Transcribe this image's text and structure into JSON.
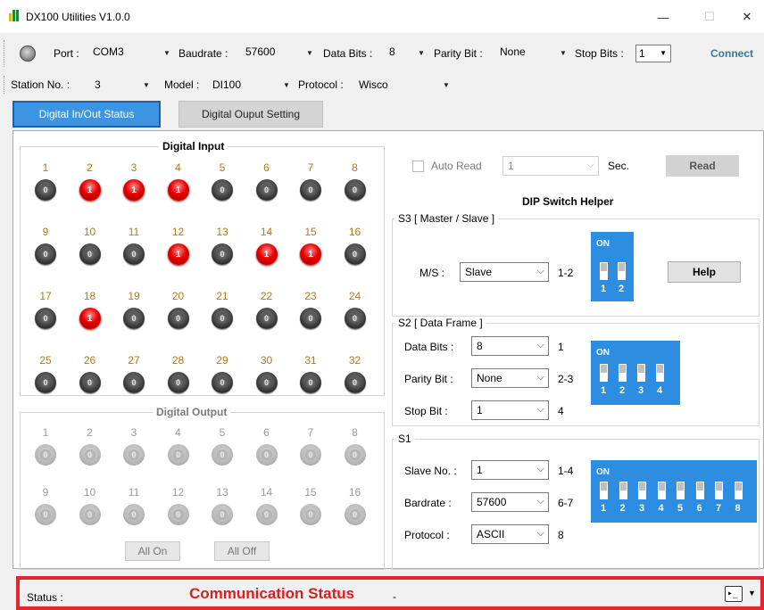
{
  "window": {
    "title": "DX100 Utilities V1.0.0",
    "minimize": "—",
    "maximize": "☐",
    "close": "✕"
  },
  "toolbar1": {
    "port_label": "Port :",
    "port_value": "COM3",
    "baud_label": "Baudrate :",
    "baud_value": "57600",
    "databits_label": "Data Bits :",
    "databits_value": "8",
    "parity_label": "Parity Bit :",
    "parity_value": "None",
    "stopbits_label": "Stop Bits :",
    "stopbits_value": "1",
    "connect_label": "Connect"
  },
  "toolbar2": {
    "station_label": "Station No. :",
    "station_value": "3",
    "model_label": "Model :",
    "model_value": "DI100",
    "protocol_label": "Protocol :",
    "protocol_value": "Wisco"
  },
  "tabs": {
    "active": "Digital In/Out Status",
    "inactive": "Digital Ouput Setting"
  },
  "digital_input": {
    "title": "Digital Input",
    "numbers": [
      "1",
      "2",
      "3",
      "4",
      "5",
      "6",
      "7",
      "8",
      "9",
      "10",
      "11",
      "12",
      "13",
      "14",
      "15",
      "16",
      "17",
      "18",
      "19",
      "20",
      "21",
      "22",
      "23",
      "24",
      "25",
      "26",
      "27",
      "28",
      "29",
      "30",
      "31",
      "32"
    ],
    "states": [
      0,
      1,
      1,
      1,
      0,
      0,
      0,
      0,
      0,
      0,
      0,
      1,
      0,
      1,
      1,
      0,
      0,
      1,
      0,
      0,
      0,
      0,
      0,
      0,
      0,
      0,
      0,
      0,
      0,
      0,
      0,
      0
    ]
  },
  "digital_output": {
    "title": "Digital Output",
    "numbers": [
      "1",
      "2",
      "3",
      "4",
      "5",
      "6",
      "7",
      "8",
      "9",
      "10",
      "11",
      "12",
      "13",
      "14",
      "15",
      "16"
    ],
    "all_on": "All On",
    "all_off": "All Off"
  },
  "auto_read": {
    "label": "Auto Read",
    "value": "1",
    "unit": "Sec.",
    "read_button": "Read"
  },
  "dip_helper": {
    "title": "DIP Switch Helper",
    "s3": {
      "title": "S3 [ Master / Slave ]",
      "ms_label": "M/S :",
      "ms_value": "Slave",
      "ms_pins": "1-2",
      "help": "Help"
    },
    "s2": {
      "title": "S2 [ Data Frame ]",
      "data_bits_label": "Data Bits :",
      "data_bits_value": "8",
      "data_bits_pins": "1",
      "parity_label": "Parity Bit :",
      "parity_value": "None",
      "parity_pins": "2-3",
      "stop_label": "Stop Bit :",
      "stop_value": "1",
      "stop_pins": "4"
    },
    "s1": {
      "title": "S1",
      "slave_label": "Slave No. :",
      "slave_value": "1",
      "slave_pins": "1-4",
      "baud_label": "Bardrate :",
      "baud_value": "57600",
      "baud_pins": "6-7",
      "protocol_label": "Protocol :",
      "protocol_value": "ASCII",
      "protocol_pins": "8"
    },
    "dip_on_label": "ON",
    "switch_numbers": [
      "1",
      "2",
      "3",
      "4",
      "5",
      "6",
      "7",
      "8"
    ]
  },
  "status": {
    "label": "Status :",
    "title": "Communication Status",
    "value": "-",
    "console_glyph": "▸_"
  }
}
